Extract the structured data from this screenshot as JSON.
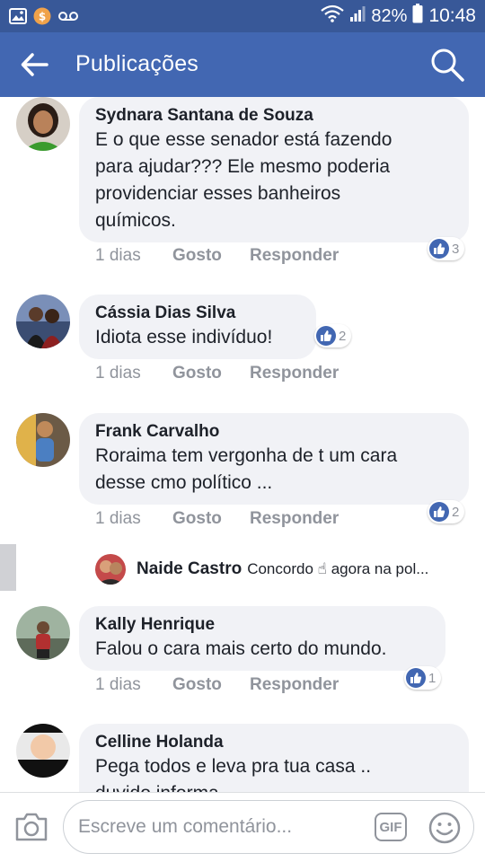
{
  "status_bar": {
    "battery_percent": "82%",
    "time": "10:48",
    "icons": [
      "gallery-icon",
      "coin-notification-icon",
      "voicemail-icon",
      "wifi-icon",
      "signal-icon",
      "battery-icon"
    ]
  },
  "app_bar": {
    "title": "Publicações",
    "icons": [
      "back-arrow-icon",
      "search-icon"
    ],
    "color": "#4267b2"
  },
  "comments": [
    {
      "name": "Sydnara Santana de Souza",
      "text": "E o que esse senador está fazendo\npara ajudar??? Ele mesmo poderia\nprovidenciar esses banheiros\nquímicos.",
      "time": "1 dias",
      "like_label": "Gosto",
      "reply_label": "Responder",
      "reactions": "3"
    },
    {
      "name": "Cássia Dias Silva",
      "text": "Idiota esse indivíduo!",
      "time": "1 dias",
      "like_label": "Gosto",
      "reply_label": "Responder",
      "reactions": "2"
    },
    {
      "name": "Frank Carvalho",
      "text": "Roraima tem vergonha de t um cara\ndesse cmo político ...",
      "time": "1 dias",
      "like_label": "Gosto",
      "reply_label": "Responder",
      "reactions": "2"
    },
    {
      "name": "Kally Henrique",
      "text": "Falou o cara mais certo do mundo.",
      "time": "1 dias",
      "like_label": "Gosto",
      "reply_label": "Responder",
      "reactions": "1"
    },
    {
      "name": "Celline Holanda",
      "text": "Pega todos e leva pra tua casa ..\nduvido informa..."
    }
  ],
  "reply_preview": {
    "name": "Naide Castro",
    "text": "Concordo ☝ agora na pol..."
  },
  "composer": {
    "placeholder": "Escreve um comentário...",
    "gif_label": "GIF",
    "icons": [
      "camera-icon",
      "emoji-icon"
    ]
  },
  "colors": {
    "status_bar": "#385898",
    "bubble": "#f1f2f6",
    "muted_text": "#90949c",
    "like_badge": "#4267b2"
  }
}
